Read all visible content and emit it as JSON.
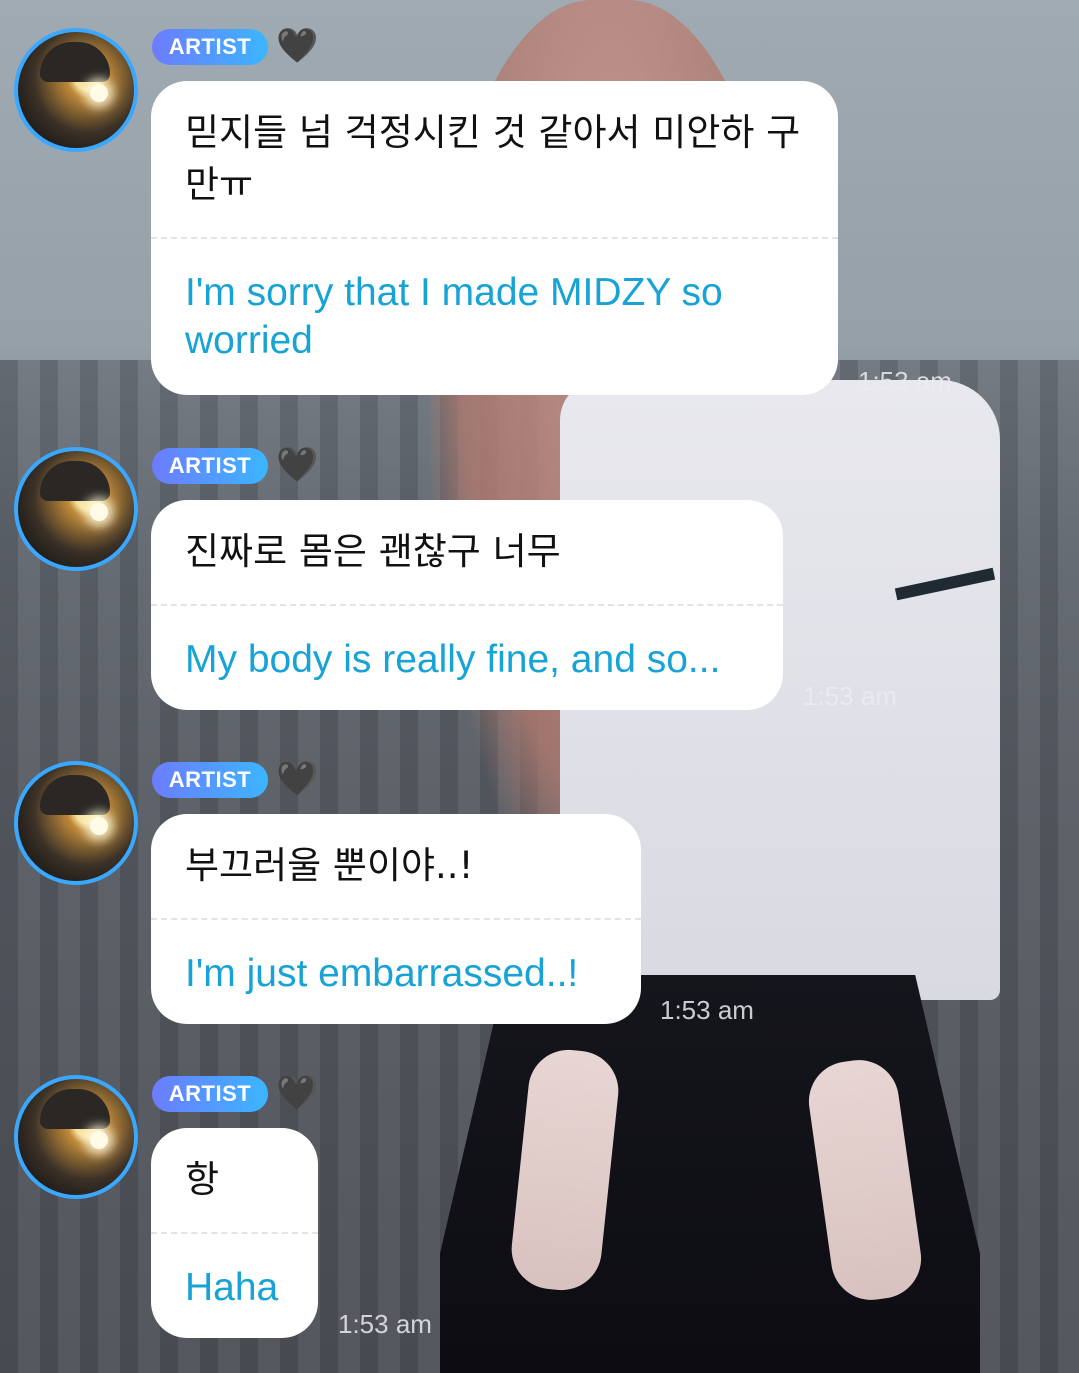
{
  "messages": [
    {
      "badge": "ARTIST",
      "heart": "🖤",
      "original": "믿지들 넘 걱정시킨 것 같아서 미안하 구만ㅠ",
      "translation": "I'm sorry that I made MIDZY so worried",
      "time": "1:53 am"
    },
    {
      "badge": "ARTIST",
      "heart": "🖤",
      "original": "진짜로 몸은 괜찮구 너무",
      "translation": "My body is really fine, and so...",
      "time": "1:53 am"
    },
    {
      "badge": "ARTIST",
      "heart": "🖤",
      "original": "부끄러울 뿐이야..!",
      "translation": "I'm just embarrassed..!",
      "time": "1:53 am"
    },
    {
      "badge": "ARTIST",
      "heart": "🖤",
      "original": "항",
      "translation": "Haha",
      "time": "1:53 am"
    }
  ],
  "colors": {
    "badge_gradient_start": "#6c7cff",
    "badge_gradient_end": "#3bb6ff",
    "avatar_ring": "#3aa8ff",
    "translation_text": "#18a3d6"
  },
  "icons": [
    "black-heart-icon",
    "artist-avatar"
  ]
}
